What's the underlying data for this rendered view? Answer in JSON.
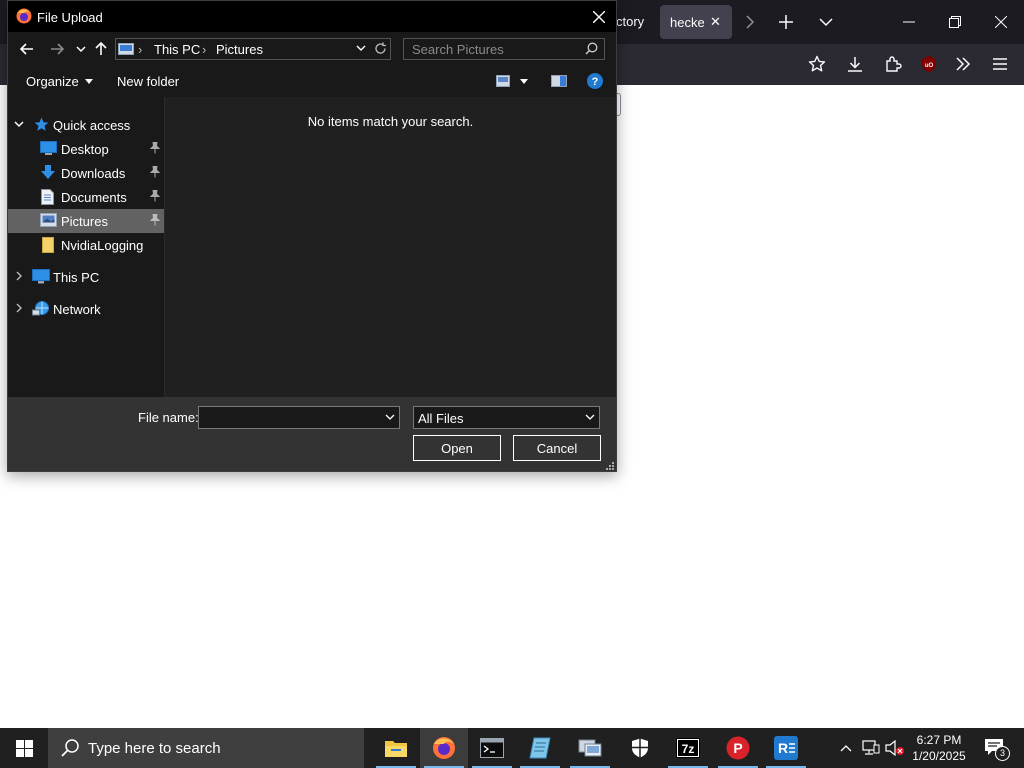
{
  "dialog": {
    "title": "File Upload",
    "breadcrumb": [
      "This PC",
      "Pictures"
    ],
    "search_placeholder": "Search Pictures",
    "toolbar": {
      "organize": "Organize",
      "new_folder": "New folder"
    },
    "nav": {
      "quick_access": "Quick access",
      "items": [
        {
          "label": "Desktop",
          "icon": "desktop-icon",
          "pinned": true
        },
        {
          "label": "Downloads",
          "icon": "downloads-icon",
          "pinned": true
        },
        {
          "label": "Documents",
          "icon": "documents-icon",
          "pinned": true
        },
        {
          "label": "Pictures",
          "icon": "pictures-icon",
          "pinned": true,
          "selected": true
        },
        {
          "label": "NvidiaLogging",
          "icon": "folder-icon",
          "pinned": false
        }
      ],
      "this_pc": "This PC",
      "network": "Network"
    },
    "empty_message": "No items match your search.",
    "file_name_label": "File name:",
    "file_name_value": "",
    "file_type": "All Files",
    "open_button": "Open",
    "cancel_button": "Cancel"
  },
  "browser": {
    "partial_tab_text": "ctory",
    "active_tab_title": "hecker"
  },
  "taskbar": {
    "search_placeholder": "Type here to search",
    "clock_time": "6:27 PM",
    "clock_date": "1/20/2025",
    "notification_count": "3"
  },
  "colors": {
    "dialog_bg": "#1a1a1a",
    "content_bg": "#202020",
    "selection": "#626262",
    "accent": "#0078d4",
    "taskbar": "#202020"
  }
}
